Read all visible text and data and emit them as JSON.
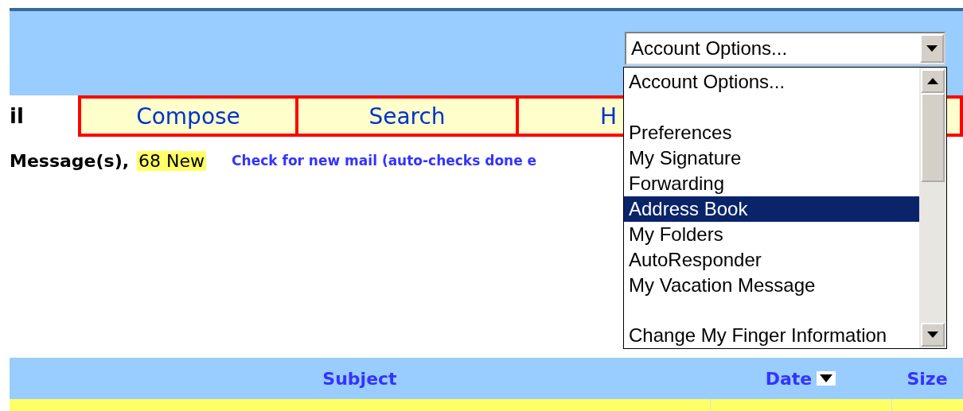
{
  "account_select": {
    "value": "Account Options...",
    "expanded": true
  },
  "account_menu": {
    "items": [
      {
        "kind": "option",
        "label": "Account Options...",
        "selected": false
      },
      {
        "kind": "blank"
      },
      {
        "kind": "option",
        "label": "Preferences",
        "selected": false
      },
      {
        "kind": "option",
        "label": "My Signature",
        "selected": false
      },
      {
        "kind": "option",
        "label": "Forwarding",
        "selected": false
      },
      {
        "kind": "option",
        "label": "Address Book",
        "selected": true
      },
      {
        "kind": "option",
        "label": "My Folders",
        "selected": false
      },
      {
        "kind": "option",
        "label": "AutoResponder",
        "selected": false
      },
      {
        "kind": "option",
        "label": "My Vacation Message",
        "selected": false
      },
      {
        "kind": "blank"
      },
      {
        "kind": "option",
        "label": "Change My Finger Information",
        "selected": false
      }
    ]
  },
  "nav": {
    "section_label": "il",
    "tabs": [
      {
        "label": "Compose"
      },
      {
        "label": "Search"
      },
      {
        "label": "H"
      }
    ]
  },
  "status": {
    "message_count": "Message(s),",
    "new_count": "68 New",
    "check_link": "Check for new mail (auto-checks done e"
  },
  "table": {
    "columns": [
      {
        "label": "Subject",
        "sorted": false
      },
      {
        "label": "Date",
        "sorted": true
      },
      {
        "label": "Size",
        "sorted": false
      }
    ]
  }
}
